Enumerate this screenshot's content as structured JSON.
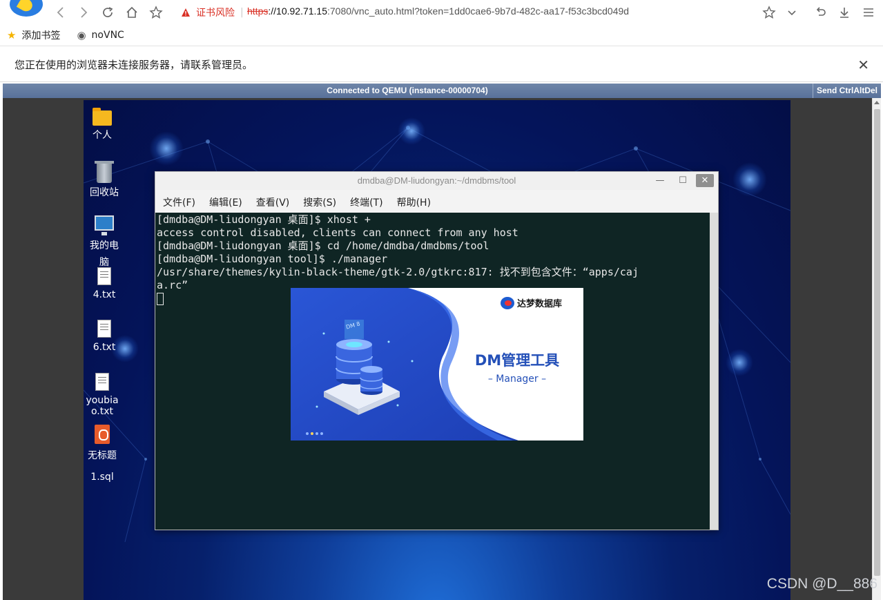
{
  "browser": {
    "cert_warning": "证书风险",
    "url_proto": "https",
    "url_host": "://10.92.71.15",
    "url_rest": ":7080/vnc_auto.html?token=1dd0cae6-9b7d-482c-aa17-f53c3bcd049d"
  },
  "bookmarks": {
    "add": "添加书签",
    "novnc": "noVNC"
  },
  "infobar": {
    "message": "您正在使用的浏览器未连接服务器，请联系管理员。"
  },
  "vnc": {
    "status": "Connected to QEMU (instance-00000704)",
    "send_ctrl_alt_del": "Send CtrlAltDel"
  },
  "desktop": {
    "icons": [
      {
        "label": "个人"
      },
      {
        "label": "回收站"
      },
      {
        "label": "我的电脑"
      },
      {
        "label": "4.txt"
      },
      {
        "label": "6.txt"
      },
      {
        "label": "youbiao.txt"
      },
      {
        "label": "无标题1.sql"
      }
    ]
  },
  "terminal": {
    "title": "dmdba@DM-liudongyan:~/dmdbms/tool",
    "menu": [
      "文件(F)",
      "编辑(E)",
      "查看(V)",
      "搜索(S)",
      "终端(T)",
      "帮助(H)"
    ],
    "lines": [
      "[dmdba@DM-liudongyan 桌面]$ xhost +",
      "access control disabled, clients can connect from any host",
      "[dmdba@DM-liudongyan 桌面]$ cd /home/dmdba/dmdbms/tool",
      "[dmdba@DM-liudongyan tool]$ ./manager",
      "/usr/share/themes/kylin-black-theme/gtk-2.0/gtkrc:817: 找不到包含文件：“apps/caj",
      "a.rc”"
    ]
  },
  "splash": {
    "brand": "达梦数据库",
    "title": "DM管理工具",
    "subtitle": "– Manager –",
    "badge": "DM 8"
  },
  "watermark": "CSDN @D__886"
}
